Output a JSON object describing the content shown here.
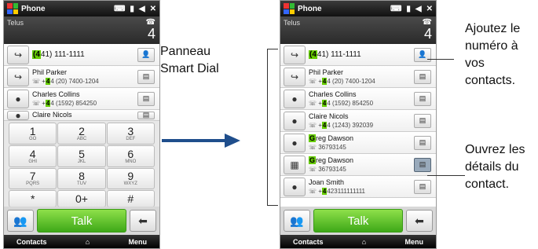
{
  "colors": {
    "accent": "#3ea818",
    "arrow": "#1f4e8c",
    "highlight": "#66cc00"
  },
  "phoneA": {
    "title": "Phone",
    "carrier": "Telus",
    "missed_count": "4",
    "rows": [
      {
        "pre": "",
        "hl": "(4",
        "post": "41) 111-1111",
        "num_pre": "",
        "num_hl": "",
        "num_post": "",
        "right_icon": "add-contact-icon"
      },
      {
        "name": "Phil Parker",
        "num_pre": "+",
        "num_hl": "4",
        "num_post": "4 (20) 7400-1204"
      },
      {
        "name": "Charles Collins",
        "num_pre": "+",
        "num_hl": "4",
        "num_post": "4 (1592) 854250"
      },
      {
        "name": "Claire Nicols"
      }
    ],
    "keys": [
      {
        "d": "1",
        "s": "GO"
      },
      {
        "d": "2",
        "s": "ABC"
      },
      {
        "d": "3",
        "s": "DEF"
      },
      {
        "d": "4",
        "s": "GHI"
      },
      {
        "d": "5",
        "s": "JKL"
      },
      {
        "d": "6",
        "s": "MNO"
      },
      {
        "d": "7",
        "s": "PQRS"
      },
      {
        "d": "8",
        "s": "TUV"
      },
      {
        "d": "9",
        "s": "WXYZ"
      },
      {
        "d": "*",
        "s": ""
      },
      {
        "d": "0+",
        "s": ""
      },
      {
        "d": "#",
        "s": ""
      }
    ],
    "talk": "Talk",
    "soft_left": "Contacts",
    "soft_right": "Menu"
  },
  "phoneB": {
    "title": "Phone",
    "carrier": "Telus",
    "missed_count": "4",
    "rows": [
      {
        "first_hl": "(4",
        "first_post": "41) 111-1111"
      },
      {
        "name": "Phil Parker",
        "num_pre": "+",
        "num_hl": "4",
        "num_post": "4 (20) 7400-1204"
      },
      {
        "name": "Charles Collins",
        "num_pre": "+",
        "num_hl": "4",
        "num_post": "4 (1592) 854250"
      },
      {
        "name": "Claire Nicols",
        "num_pre": "+",
        "num_hl": "4",
        "num_post": "4 (1243) 392039"
      },
      {
        "name_hl": "G",
        "name_post": "reg Dawson",
        "num": "36793145"
      },
      {
        "name_hl": "G",
        "name_post": "reg Dawson",
        "num": "36793145"
      },
      {
        "name": "Joan Smith",
        "num_pre": "+",
        "num_hl": "4",
        "num_post": "423111111111"
      }
    ],
    "talk": "Talk",
    "soft_left": "Contacts",
    "soft_right": "Menu"
  },
  "captions": {
    "smart_dial": "Panneau Smart Dial",
    "add_contact": "Ajoutez le numéro à vos contacts.",
    "open_details": "Ouvrez les détails du contact."
  }
}
